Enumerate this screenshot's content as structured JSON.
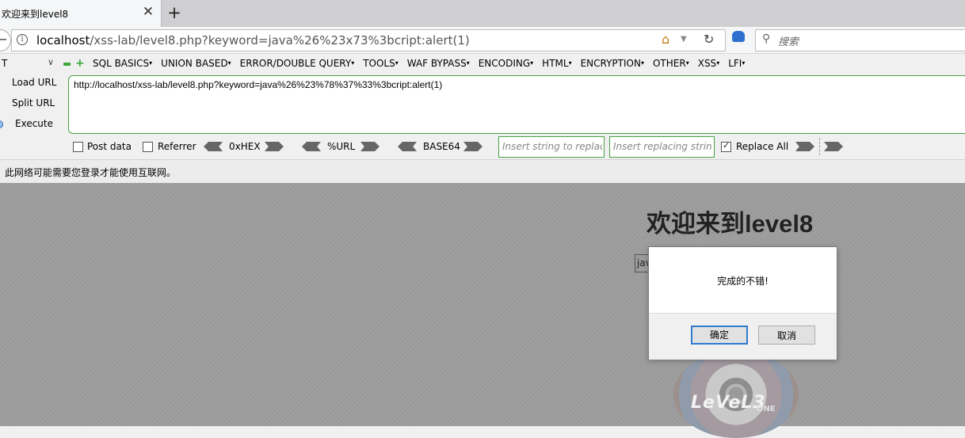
{
  "tab": {
    "title": "欢迎来到level8",
    "close_glyph": "✕",
    "new_tab_glyph": "+"
  },
  "nav": {
    "url_host": "localhost",
    "url_path": "/xss-lab/level8.php?keyword=java%26%23x73%3bcript:alert(1)",
    "search_placeholder": "搜索"
  },
  "hackbar": {
    "version": "T",
    "menu": [
      "SQL BASICS",
      "UNION BASED",
      "ERROR/DOUBLE QUERY",
      "TOOLS",
      "WAF BYPASS",
      "ENCODING",
      "HTML",
      "ENCRYPTION",
      "OTHER",
      "XSS",
      "LFI"
    ],
    "load_url": "Load URL",
    "split_url": "Split URL",
    "execute": "Execute",
    "textarea_value": "http://localhost/xss-lab/level8.php?keyword=java%26%23%78%37%33%3bcript:alert(1)",
    "post_data": "Post data",
    "referrer": "Referrer",
    "hex": "0xHEX",
    "url_enc": "%URL",
    "base64": "BASE64",
    "find_placeholder": "Insert string to replace",
    "replace_placeholder": "Insert replacing string",
    "replace_all": "Replace All",
    "replace_all_checked": true
  },
  "notification": "此网络可能需要您登录才能使用互联网。",
  "page": {
    "heading": "欢迎来到level8",
    "input_value": "java",
    "logo_text": "LeVeL3",
    "logo_sub": "ONE"
  },
  "dialog": {
    "message": "完成的不错!",
    "ok": "确定",
    "cancel": "取消"
  },
  "colors": {
    "hackbar_border": "#46a246",
    "dialog_primary_border": "#2f7bd0"
  }
}
